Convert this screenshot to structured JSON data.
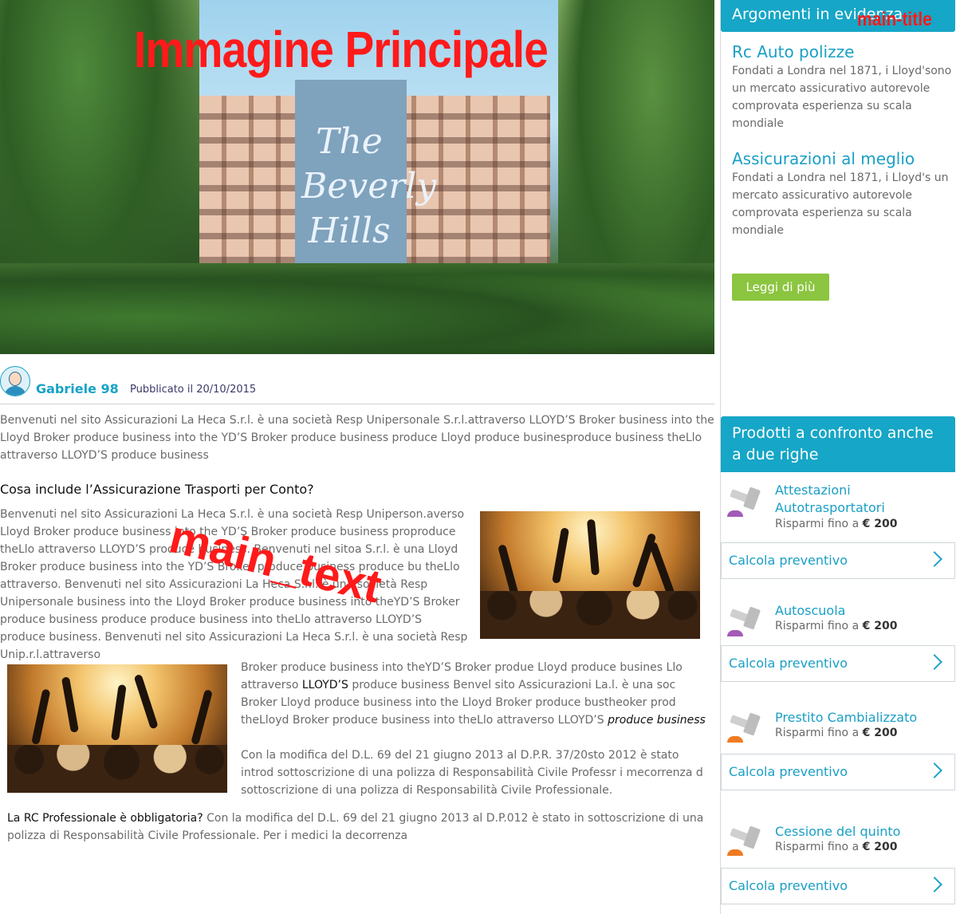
{
  "hero": {
    "overlay_label": "Immagine Principale",
    "sign_text": "The Beverly Hills"
  },
  "overlays": {
    "main_text_label": "main_text",
    "main_title_label": "main-title"
  },
  "author": {
    "name": "Gabriele 98",
    "published": "Pubblicato il 20/10/2015"
  },
  "article": {
    "intro": "Benvenuti nel sito Assicurazioni La Heca S.r.l. è una società Resp Unipersonale S.r.l.attraverso LLOYD’S Broker business into the Lloyd Broker produce business into the YD’S Broker produce business produce Lloyd produce businesproduce business theLlo attraverso LLOYD’S produce business",
    "section_heading": "Cosa include l’Assicurazione Trasporti per Conto?",
    "para2": "Benvenuti nel sito Assicurazioni La Heca S.r.l. è una società Resp Uniperson.averso Lloyd Broker produce business into the YD’S Broker produce business proproduce theLlo attraverso LLOYD’S produce business. Benvenuti nel sitoa S.r.l. è una Lloyd Broker produce business into the YD’S Broker produce business produce bu theLlo attraverso. Benvenuti nel sito Assicurazioni La Heca S.r.l. è una società Resp Unipersonale business into the Lloyd Broker produce business into theYD’S Broker produce business produce produce business into theLlo attraverso LLOYD’S produce business. Benvenuti nel sito Assicurazioni La Heca S.r.l. è una società Resp Unip.r.l.attraverso",
    "para3_a": "Broker produce business into theYD’S Broker produe Lloyd produce busines Llo attraverso ",
    "para3_b": "LLOYD’S",
    "para3_c": " produce business Benvel sito Assicurazioni La.l. è una soc Broker Lloyd produce business into the Lloyd Broker produce bustheoker prod theLloyd Broker produce business into theLlo attraverso LLOYD’S ",
    "para3_d": "produce business",
    "para4": "Con la modifica del D.L. 69 del 21 giugno 2013 al D.P.R. 37/20sto 2012 è stato introd sottoscrizione di una polizza di Responsabilità Civile Professr i mecorrenza d sottoscrizione di una polizza di Responsabilità Civile Professionale.",
    "para5_a": "La RC Professionale è obbligatoria?",
    "para5_b": " Con la modifica del D.L. 69 del 21 giugno 2013 al D.P.012 è stato in sottoscrizione di una polizza di Responsabilità Civile Professionale. Per i medici la decorrenza"
  },
  "sidebar": {
    "featured_heading": "Argomenti in evidenza",
    "featured": [
      {
        "title": "Rc Auto polizze",
        "desc": "Fondati a Londra nel 1871, i Lloyd'sono un mercato assicurativo autorevole comprovata esperienza su scala mondiale"
      },
      {
        "title": "Assicurazioni al meglio",
        "desc": "Fondati a Londra nel 1871, i Lloyd's un mercato assicurativo autorevole comprovata esperienza su scala mondiale"
      }
    ],
    "read_more": "Leggi di più",
    "products_heading": "Prodotti a confronto anche a due righe",
    "products": [
      {
        "name": "Attestazioni Autotrasportatori",
        "save_prefix": "Risparmi fino a ",
        "amount": "€ 200",
        "cta": "Calcola preventivo",
        "accent": "#a45ab8"
      },
      {
        "name": "Autoscuola",
        "save_prefix": "Risparmi fino a ",
        "amount": "€ 200",
        "cta": "Calcola preventivo",
        "accent": "#a45ab8"
      },
      {
        "name": "Prestito Cambializzato",
        "save_prefix": "Risparmi fino a ",
        "amount": "€ 200",
        "cta": "Calcola preventivo",
        "accent": "#f07a22"
      },
      {
        "name": "Cessione del quinto",
        "save_prefix": "Risparmi fino a ",
        "amount": "€ 200",
        "cta": "Calcola preventivo",
        "accent": "#f07a22"
      }
    ]
  },
  "icons": [
    "avatar-icon",
    "gavel-icon",
    "chevron-right-icon"
  ],
  "colors": {
    "brand": "#16a6c7",
    "cta_green": "#8cc540",
    "overlay_red": "#ff1a1a"
  }
}
